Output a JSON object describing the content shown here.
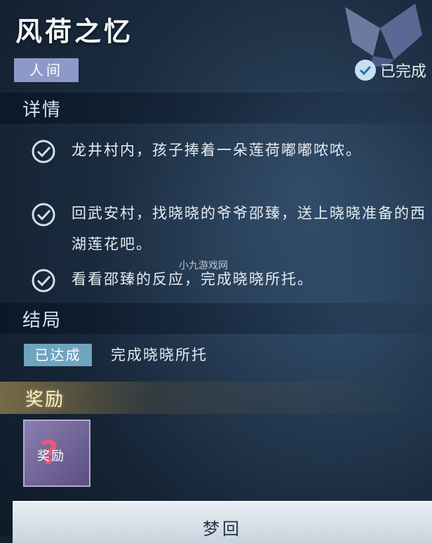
{
  "quest": {
    "title": "风荷之忆",
    "realm_tag": "人间",
    "status": "已完成"
  },
  "details": {
    "heading": "详情",
    "tasks": [
      {
        "text": "龙井村内，孩子捧着一朵莲荷嘟嘟哝哝。",
        "done": true
      },
      {
        "text": "回武安村，找晓晓的爷爷邵臻，送上晓晓准备的西湖莲花吧。",
        "done": true
      },
      {
        "text": "看看邵臻的反应，完成晓晓所托。",
        "done": true
      }
    ]
  },
  "ending": {
    "heading": "结局",
    "badge": "已达成",
    "text": "完成晓晓所托"
  },
  "rewards": {
    "heading": "奖励",
    "item_label": "奖励"
  },
  "dream_button": "梦回",
  "watermark": "小九游戏网",
  "colors": {
    "tag_bg": "#8d9ac9",
    "badge_bg": "#6fa4bf",
    "reward_gold": "#fbf0c8"
  },
  "icons": {
    "status": "check-circle-icon",
    "task": "check-icon",
    "emblem": "crystal-emblem-icon",
    "reward": "question-mark-icon"
  }
}
